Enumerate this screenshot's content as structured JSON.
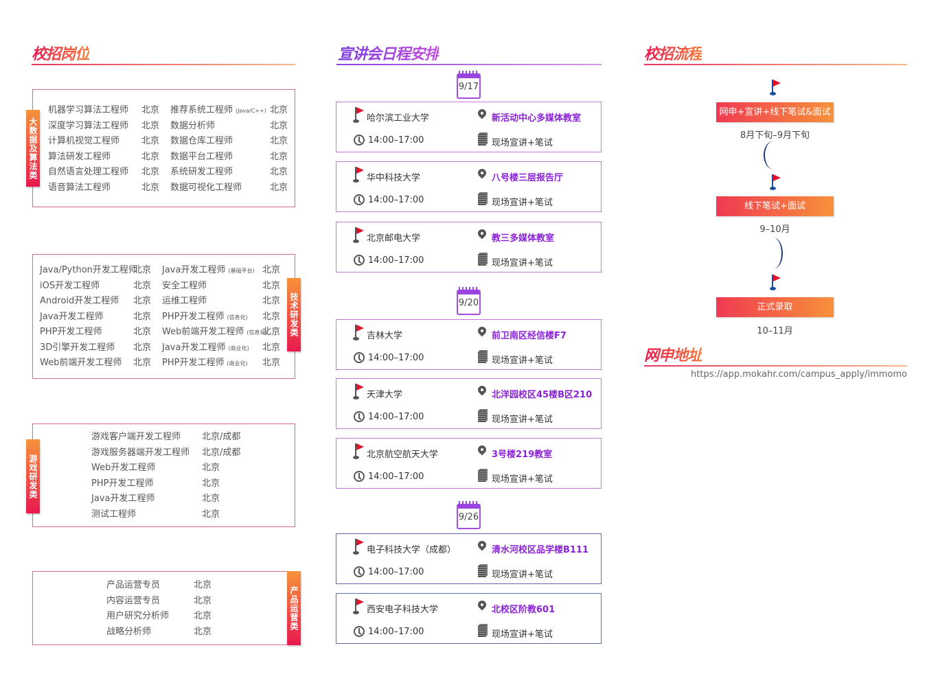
{
  "positions": {
    "title": "校招岗位",
    "groups": [
      {
        "tag": "大数据及算法类",
        "rows": [
          [
            "机器学习算法工程师",
            "北京",
            "推荐系统工程师",
            "(Java/C++)",
            "北京"
          ],
          [
            "深度学习算法工程师",
            "北京",
            "数据分析师",
            "",
            "北京"
          ],
          [
            "计算机视觉工程师",
            "北京",
            "数据仓库工程师",
            "",
            "北京"
          ],
          [
            "算法研发工程师",
            "北京",
            "数据平台工程师",
            "",
            "北京"
          ],
          [
            "自然语言处理工程师",
            "北京",
            "系统研发工程师",
            "",
            "北京"
          ],
          [
            "语音算法工程师",
            "北京",
            "数据可视化工程师",
            "",
            "北京"
          ]
        ]
      },
      {
        "tag": "技术研发类",
        "rows": [
          [
            "Java/Python开发工程师",
            "北京",
            "Java开发工程师",
            "(基础平台)",
            "北京"
          ],
          [
            "iOS开发工程师",
            "北京",
            "安全工程师",
            "",
            "北京"
          ],
          [
            "Android开发工程师",
            "北京",
            "运维工程师",
            "",
            "北京"
          ],
          [
            "Java开发工程师",
            "北京",
            "PHP开发工程师",
            "(信息化)",
            "北京"
          ],
          [
            "PHP开发工程师",
            "北京",
            "Web前端开发工程师",
            "(信息化)",
            "北京"
          ],
          [
            "3D引擎开发工程师",
            "北京",
            "Java开发工程师",
            "(商业化)",
            "北京"
          ],
          [
            "Web前端开发工程师",
            "北京",
            "PHP开发工程师",
            "(商业化)",
            "北京"
          ]
        ]
      },
      {
        "tag": "游戏研发类",
        "rows": [
          [
            "游戏客户端开发工程师",
            "北京/成都"
          ],
          [
            "游戏服务器端开发工程师",
            "北京/成都"
          ],
          [
            "Web开发工程师",
            "北京"
          ],
          [
            "PHP开发工程师",
            "北京"
          ],
          [
            "Java开发工程师",
            "北京"
          ],
          [
            "测试工程师",
            "北京"
          ]
        ]
      },
      {
        "tag": "产品运营类",
        "rows": [
          [
            "产品运营专员",
            "北京"
          ],
          [
            "内容运营专员",
            "北京"
          ],
          [
            "用户研究分析师",
            "北京"
          ],
          [
            "战略分析师",
            "北京"
          ]
        ]
      }
    ]
  },
  "schedule": {
    "title": "宣讲会日程安排",
    "days": [
      {
        "date": "9/17",
        "sessions": [
          {
            "school": "哈尔滨工业大学",
            "location": "新活动中心多媒体教室",
            "time": "14:00–17:00",
            "type": "现场宣讲+笔试"
          },
          {
            "school": "华中科技大学",
            "location": "八号楼三层报告厅",
            "time": "14:00–17:00",
            "type": "现场宣讲+笔试"
          },
          {
            "school": "北京邮电大学",
            "location": "教三多媒体教室",
            "time": "14:00–17:00",
            "type": "现场宣讲+笔试"
          }
        ]
      },
      {
        "date": "9/20",
        "sessions": [
          {
            "school": "吉林大学",
            "location": "前卫南区经信楼F7",
            "time": "14:00–17:00",
            "type": "现场宣讲+笔试"
          },
          {
            "school": "天津大学",
            "location": "北洋园校区45楼B区210",
            "time": "14:00–17:00",
            "type": "现场宣讲+笔试"
          },
          {
            "school": "北京航空航天大学",
            "location": "3号楼219教室",
            "time": "14:00–17:00",
            "type": "现场宣讲+笔试"
          }
        ]
      },
      {
        "date": "9/26",
        "sessions": [
          {
            "school": "电子科技大学（成都）",
            "location": "清水河校区品学楼B111",
            "time": "14:00–17:00",
            "type": "现场宣讲+笔试"
          },
          {
            "school": "西安电子科技大学",
            "location": "北校区阶教601",
            "time": "14:00–17:00",
            "type": "现场宣讲+笔试"
          }
        ]
      }
    ]
  },
  "process": {
    "title": "校招流程",
    "steps": [
      {
        "label": "网申+宣讲+线下笔试&面试",
        "period": "8月下旬–9月下旬"
      },
      {
        "label": "线下笔试+面试",
        "period": "9–10月"
      },
      {
        "label": "正式录取",
        "period": "10–11月"
      }
    ]
  },
  "apply": {
    "title": "网申地址",
    "url": "https://app.mokahr.com/campus_apply/immomo"
  },
  "colors": {
    "accent_red": "#e8194f",
    "accent_orange": "#f7913a",
    "accent_purple": "#8a22d8",
    "flag_red": "#e0142c"
  }
}
